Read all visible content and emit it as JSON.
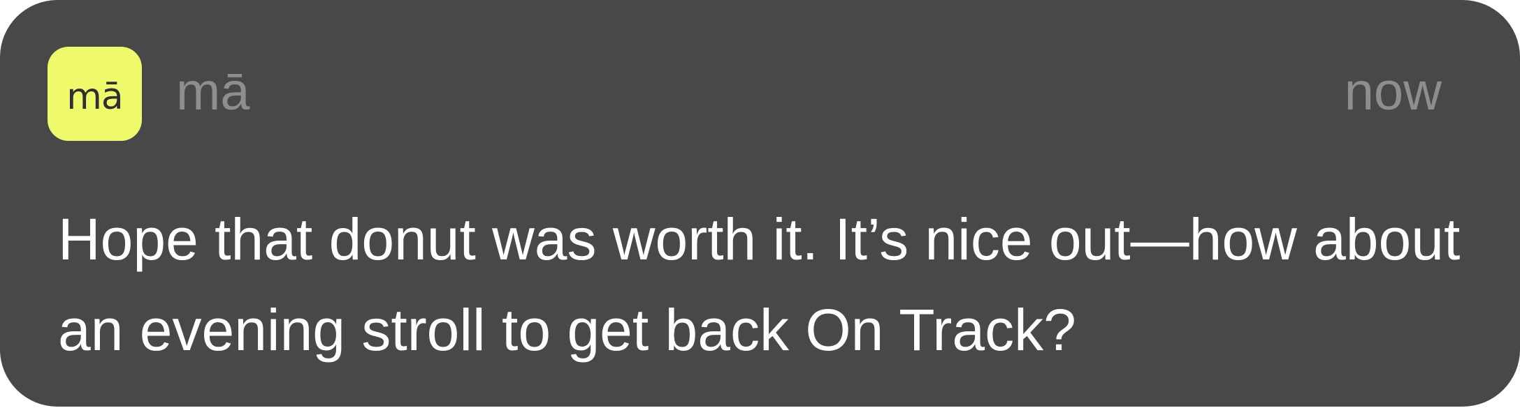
{
  "notification": {
    "app_icon": {
      "text": "mā",
      "background_color": "#eefa6b",
      "text_color": "#2f2f2f"
    },
    "app_name": "mā",
    "timestamp": "now",
    "message": "Hope that donut was worth it. It’s nice out—how about an evening stroll to get back On Track?",
    "background_color": "#484848",
    "secondary_text_color": "#8e8e8e",
    "primary_text_color": "#ffffff"
  }
}
